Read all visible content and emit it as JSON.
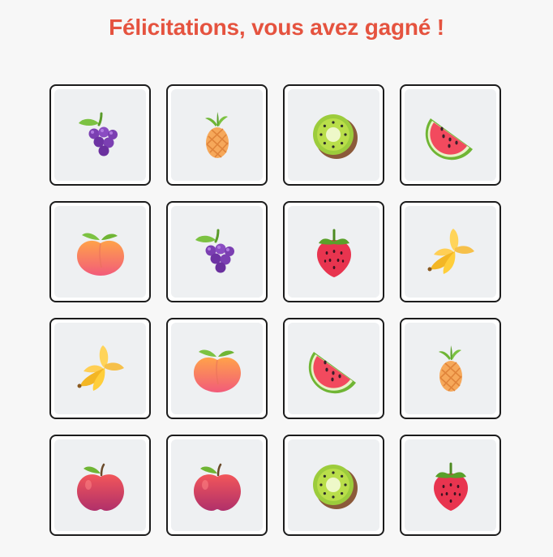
{
  "header": {
    "title": "Félicitations, vous avez gagné !"
  },
  "board": {
    "cards": [
      {
        "fruit": "grapes-icon"
      },
      {
        "fruit": "pineapple-icon"
      },
      {
        "fruit": "kiwi-icon"
      },
      {
        "fruit": "watermelon-icon"
      },
      {
        "fruit": "peach-icon"
      },
      {
        "fruit": "grapes-icon"
      },
      {
        "fruit": "strawberry-icon"
      },
      {
        "fruit": "banana-icon"
      },
      {
        "fruit": "banana-icon"
      },
      {
        "fruit": "peach-icon"
      },
      {
        "fruit": "watermelon-icon"
      },
      {
        "fruit": "pineapple-icon"
      },
      {
        "fruit": "apple-icon"
      },
      {
        "fruit": "apple-icon"
      },
      {
        "fruit": "kiwi-icon"
      },
      {
        "fruit": "strawberry-icon"
      }
    ]
  },
  "colors": {
    "title": "#e5533f",
    "card_border": "#1c1c1c",
    "card_face": "#eef0f2",
    "background": "#f7f7f7"
  }
}
